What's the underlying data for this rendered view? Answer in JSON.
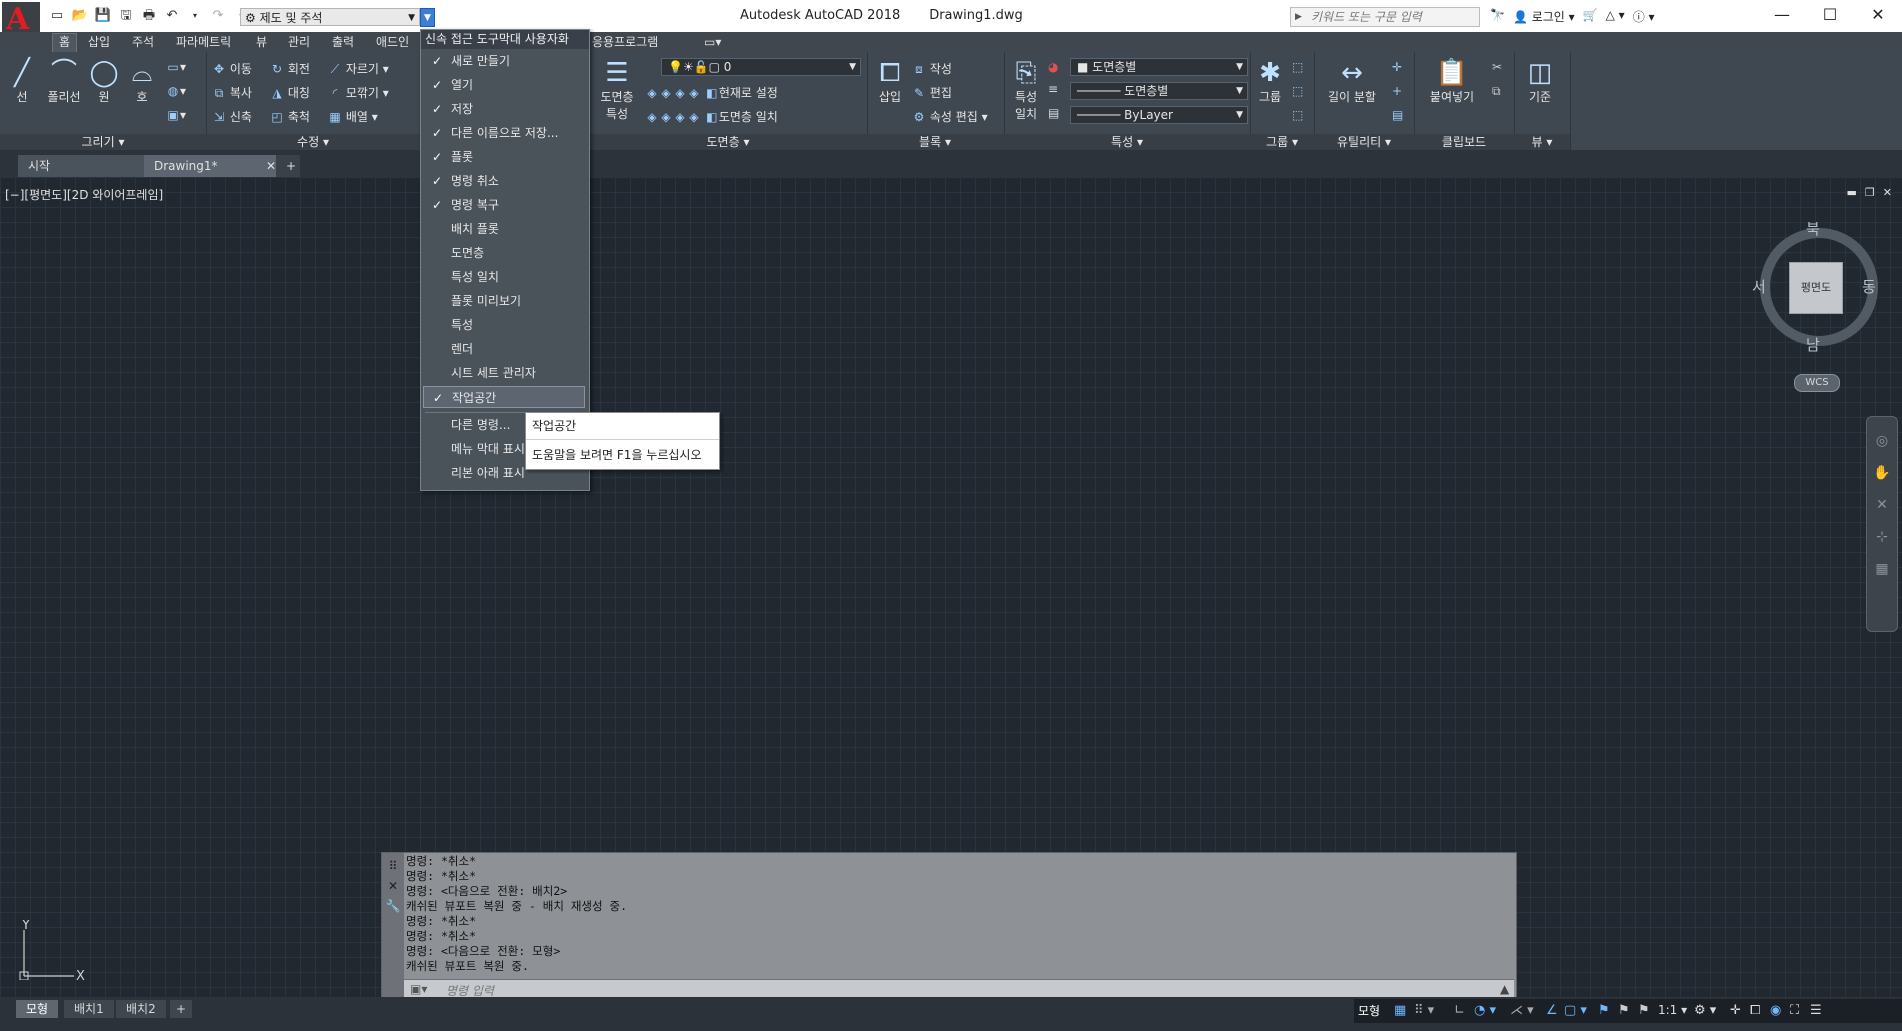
{
  "title_bar": {
    "app_title": "Autodesk AutoCAD 2018",
    "doc_title": "Drawing1.dwg",
    "workspace": "제도 및 주석",
    "search_placeholder": "키워드 또는 구문 입력",
    "login": "로그인",
    "logo": "A",
    "window_controls": [
      "—",
      "☐",
      "✕"
    ]
  },
  "ribbon_tabs": [
    "홈",
    "삽입",
    "주석",
    "파라메트릭",
    "뷰",
    "관리",
    "출력",
    "애드인",
    "응용프로그램"
  ],
  "ribbon": {
    "draw": {
      "title": "그리기",
      "buttons": [
        "선",
        "폴리선",
        "원",
        "호"
      ]
    },
    "modify": {
      "title": "수정",
      "items": [
        "이동",
        "회전",
        "자르기",
        "복사",
        "대칭",
        "모깎기",
        "신축",
        "축척",
        "배열"
      ]
    },
    "layers": {
      "title": "도면층",
      "big": [
        "도면층",
        "특성"
      ],
      "items": [
        "현재로 설정",
        "도면층 일치"
      ],
      "layer_value": "0"
    },
    "block": {
      "title": "블록",
      "big": "삽입",
      "items": [
        "작성",
        "편집",
        "속성 편집"
      ]
    },
    "properties": {
      "title": "특성",
      "big": [
        "특성",
        "일치"
      ],
      "color": "도면층별",
      "linetype": "도면층별",
      "lineweight": "ByLayer"
    },
    "groups": {
      "title": "그룹",
      "big": "그룹"
    },
    "utilities": {
      "title": "유틸리티",
      "big": "길이 분할"
    },
    "clipboard": {
      "title": "클립보드",
      "big": "붙여넣기"
    },
    "view": {
      "title": "뷰",
      "big": "기준"
    }
  },
  "file_tabs": [
    "시작",
    "Drawing1*"
  ],
  "viewport_label": "[−][평면도][2D 와이어프레임]",
  "viewcube": {
    "top": "평면도",
    "n": "북",
    "s": "남",
    "w": "서",
    "e": "동",
    "wcs": "WCS"
  },
  "ucs": {
    "x": "X",
    "y": "Y"
  },
  "qat_menu": {
    "title": "신속 접근 도구막대 사용자화",
    "items": [
      {
        "label": "새로 만들기",
        "checked": true
      },
      {
        "label": "열기",
        "checked": true
      },
      {
        "label": "저장",
        "checked": true
      },
      {
        "label": "다른 이름으로 저장...",
        "checked": true
      },
      {
        "label": "플롯",
        "checked": true
      },
      {
        "label": "명령 취소",
        "checked": true
      },
      {
        "label": "명령 복구",
        "checked": true
      },
      {
        "label": "배치 플롯",
        "checked": false
      },
      {
        "label": "도면층",
        "checked": false
      },
      {
        "label": "특성 일치",
        "checked": false
      },
      {
        "label": "플롯 미리보기",
        "checked": false
      },
      {
        "label": "특성",
        "checked": false
      },
      {
        "label": "렌더",
        "checked": false
      },
      {
        "label": "시트 세트 관리자",
        "checked": false
      },
      {
        "label": "작업공간",
        "checked": true,
        "highlighted": true
      }
    ],
    "extra": [
      "다른 명령...",
      "메뉴 막대 표시",
      "리본 아래 표시"
    ],
    "checkmark": "✓"
  },
  "tooltip": {
    "title": "작업공간",
    "help": "도움말을 보려면 F1을 누르십시오"
  },
  "command_window": {
    "history": [
      "명령: *취소*",
      "명령: *취소*",
      "명령:  <다음으로 전환: 배치2>",
      "캐쉬된 뷰포트 복원 중 - 배치 재생성 중.",
      "명령: *취소*",
      "명령: *취소*",
      "명령:  <다음으로 전환: 모형>",
      "캐쉬된 뷰포트 복원 중."
    ],
    "input_placeholder": "명령 입력"
  },
  "layout_tabs": [
    "모형",
    "배치1",
    "배치2"
  ],
  "status_bar": {
    "model_label": "모형",
    "scale": "1:1"
  },
  "colors": {
    "canvas_bg": "#212830",
    "ribbon_bg": "#3f4750",
    "accent": "#3b7fd6",
    "logo_red": "#e31b23"
  }
}
